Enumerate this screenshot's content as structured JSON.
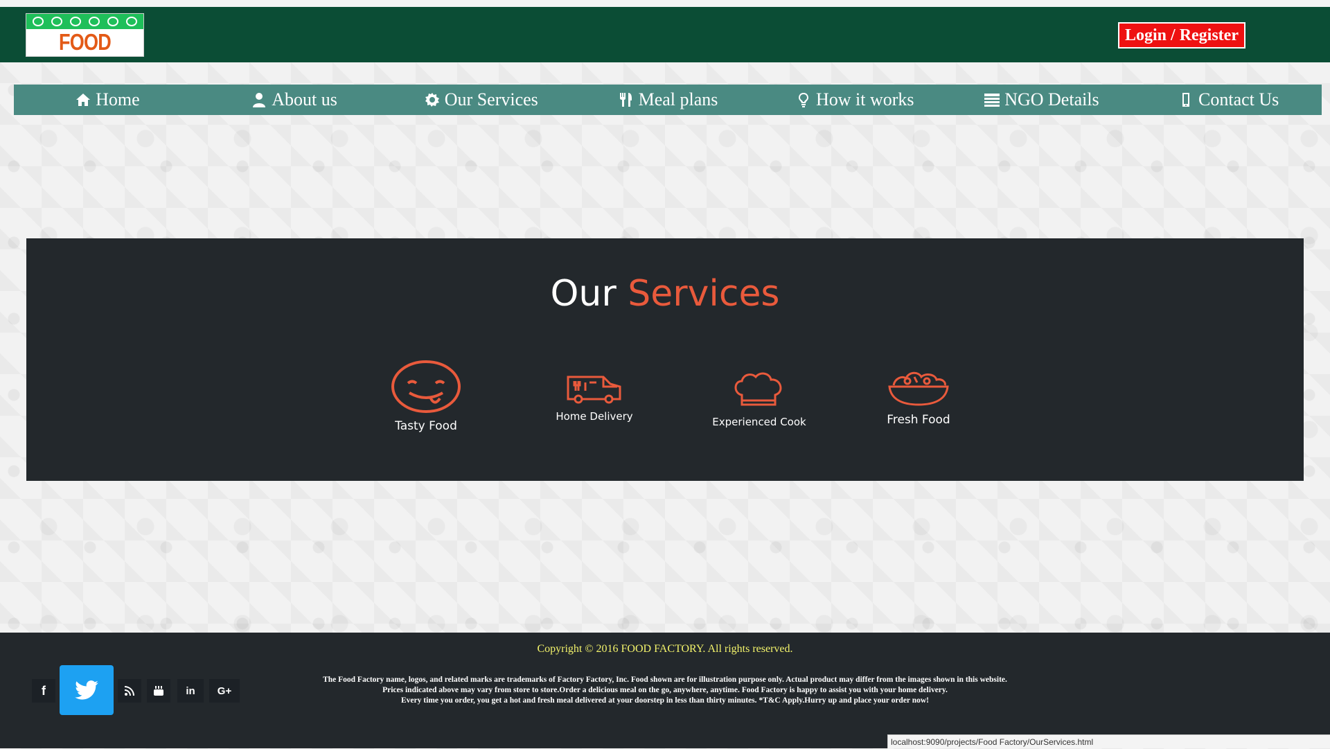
{
  "header": {
    "logo_text": "FOOD FACTORY",
    "login_label": "Login / Register"
  },
  "nav": {
    "items": [
      {
        "label": "Home",
        "icon": "home-icon"
      },
      {
        "label": "About us",
        "icon": "user-icon"
      },
      {
        "label": "Our Services",
        "icon": "gear-icon"
      },
      {
        "label": "Meal plans",
        "icon": "cutlery-icon"
      },
      {
        "label": "How it works",
        "icon": "lightbulb-icon"
      },
      {
        "label": "NGO Details",
        "icon": "list-icon"
      },
      {
        "label": "Contact Us",
        "icon": "mobile-icon"
      }
    ]
  },
  "services": {
    "title_part1": "Our",
    "title_part2": "Services",
    "items": [
      {
        "label": "Tasty Food",
        "icon": "smiley-tongue-icon"
      },
      {
        "label": "Home Delivery",
        "icon": "delivery-van-icon"
      },
      {
        "label": "Experienced Cook",
        "icon": "chef-hat-icon"
      },
      {
        "label": "Fresh Food",
        "icon": "salad-bowl-icon"
      }
    ]
  },
  "footer": {
    "copyright": "Copyright © 2016     FOOD FACTORY. All rights reserved.",
    "legal_line1": "The Food Factory name, logos, and related marks are trademarks of Factory Factory, Inc. Food shown are for illustration purpose only. Actual product may differ from the images shown in this website.",
    "legal_line2": "Prices indicated above may vary from store to store.Order a delicious meal on the go, anywhere, anytime. Food Factory is happy to assist you with your home delivery.",
    "legal_line3": "Every time you order, you get a hot and fresh meal delivered at your doorstep in less than thirty minutes. *T&C Apply.Hurry up and place your order now!",
    "social": [
      {
        "icon": "facebook-icon",
        "text": "f"
      },
      {
        "icon": "twitter-icon",
        "text": ""
      },
      {
        "icon": "rss-icon",
        "text": ""
      },
      {
        "icon": "youtube-icon",
        "text": ""
      },
      {
        "icon": "linkedin-icon",
        "text": "in"
      },
      {
        "icon": "google-plus-icon",
        "text": "G+"
      }
    ]
  },
  "status_bar": {
    "url": "localhost:9090/projects/Food Factory/OurServices.html"
  },
  "colors": {
    "header_bg": "#0b4d35",
    "nav_bg": "#4a8a82",
    "accent": "#e95a3c",
    "login_bg": "#ee1111",
    "dark_panel": "#23282c",
    "twitter": "#1da1f2",
    "copyright_text": "#f3f36b"
  }
}
